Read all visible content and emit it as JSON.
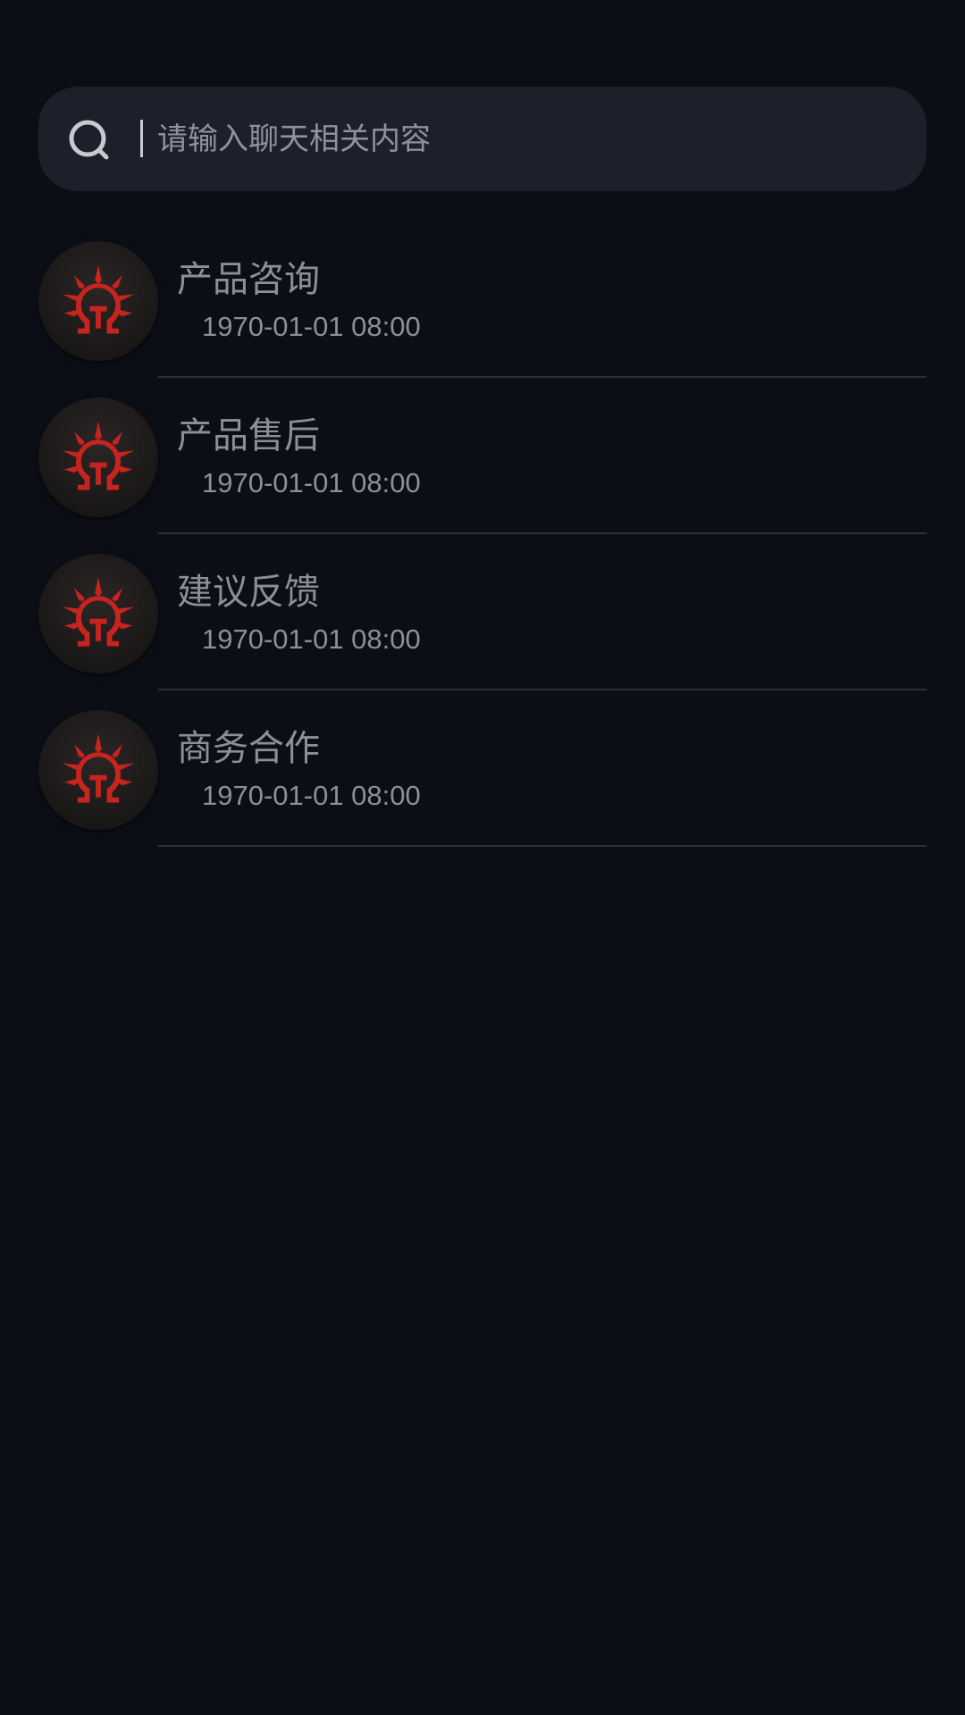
{
  "search": {
    "placeholder": "请输入聊天相关内容"
  },
  "chats": [
    {
      "title": "产品咨询",
      "time": "1970-01-01 08:00",
      "avatar_icon": "omega-sun-logo-icon"
    },
    {
      "title": "产品售后",
      "time": "1970-01-01 08:00",
      "avatar_icon": "omega-sun-logo-icon"
    },
    {
      "title": "建议反馈",
      "time": "1970-01-01 08:00",
      "avatar_icon": "omega-sun-logo-icon"
    },
    {
      "title": "商务合作",
      "time": "1970-01-01 08:00",
      "avatar_icon": "omega-sun-logo-icon"
    }
  ],
  "colors": {
    "background": "#0c0e16",
    "search_bg": "#1d1f2a",
    "text": "#8c8f98",
    "logo_red": "#c8241f",
    "divider": "#2c2f39"
  }
}
